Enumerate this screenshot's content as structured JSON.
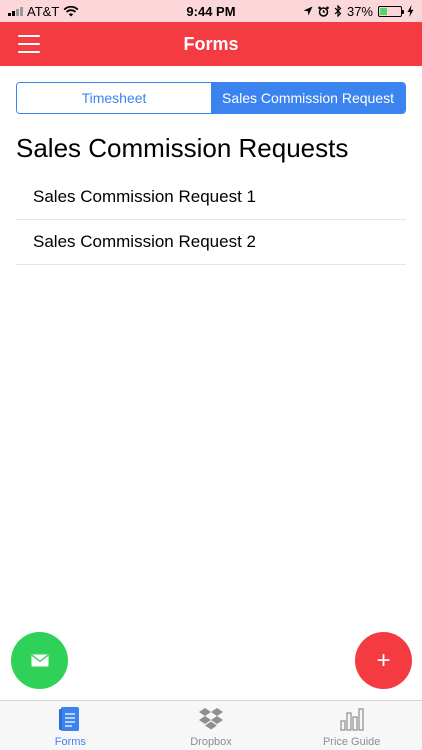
{
  "status_bar": {
    "carrier": "AT&T",
    "time": "9:44 PM",
    "battery_percent": "37%",
    "battery_level": 0.37
  },
  "nav": {
    "title": "Forms",
    "menu_icon": "hamburger-menu-icon"
  },
  "segments": [
    {
      "label": "Timesheet",
      "active": false
    },
    {
      "label": "Sales Commission Request",
      "active": true
    }
  ],
  "section": {
    "title": "Sales Commission Requests"
  },
  "requests": [
    "Sales Commission Request 1",
    "Sales Commission Request 2"
  ],
  "fabs": {
    "mail_icon": "mail-icon",
    "add_symbol": "+",
    "mail_color": "#30d158",
    "add_color": "#f53b42"
  },
  "tabs": [
    {
      "label": "Forms",
      "icon": "forms-document-icon",
      "active": true
    },
    {
      "label": "Dropbox",
      "icon": "dropbox-icon",
      "active": false
    },
    {
      "label": "Price Guide",
      "icon": "bar-chart-icon",
      "active": false
    }
  ],
  "colors": {
    "accent_red": "#f53b42",
    "accent_blue": "#3b84f0",
    "status_bar_bg": "#fbd7d9"
  }
}
